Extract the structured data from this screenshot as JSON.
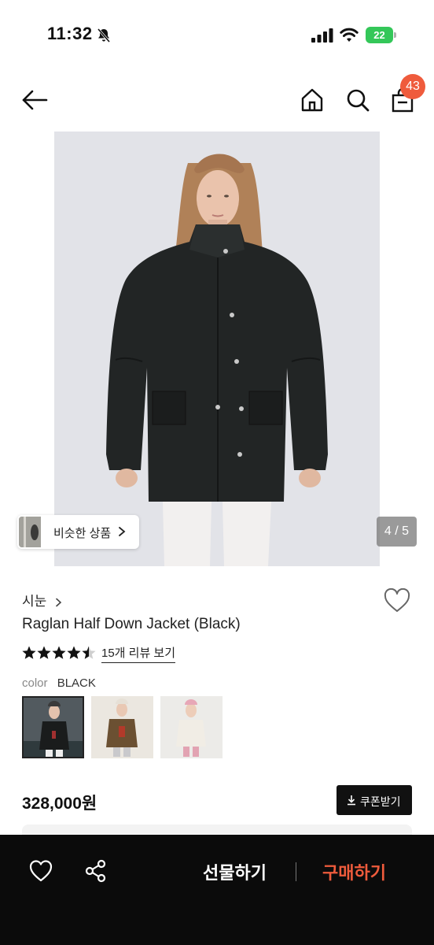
{
  "status_bar": {
    "time": "11:32",
    "battery": "22"
  },
  "nav": {
    "cart_count": "43"
  },
  "gallery": {
    "similar_label": "비슷한 상품",
    "page_indicator": "4 / 5"
  },
  "product": {
    "brand": "시눈",
    "title": "Raglan Half Down Jacket (Black)",
    "rating": 4.5,
    "rating_max": 5,
    "review_link": "15개 리뷰 보기",
    "color_label": "color",
    "color_value": "BLACK",
    "swatches": [
      {
        "name": "black",
        "selected": true
      },
      {
        "name": "brown",
        "selected": false
      },
      {
        "name": "cream",
        "selected": false
      }
    ],
    "price": "328,000원",
    "coupon_label": "쿠폰받기"
  },
  "bottom_bar": {
    "gift_label": "선물하기",
    "buy_label": "구매하기"
  },
  "colors": {
    "accent": "#ef5b3c",
    "battery": "#34c759",
    "bottom_bar": "#0b0b0b"
  },
  "icons": [
    "bell-off-icon",
    "signal-icon",
    "wifi-icon",
    "back-arrow-icon",
    "home-icon",
    "search-icon",
    "bag-icon",
    "chevron-right-icon",
    "heart-icon",
    "star-icon",
    "download-icon",
    "share-icon"
  ]
}
